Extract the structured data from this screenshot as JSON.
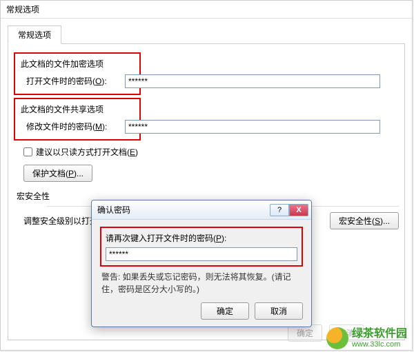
{
  "main": {
    "title": "常规选项",
    "tab_label": "常规选项",
    "section1_title": "此文档的文件加密选项",
    "open_pw_label": "打开文件时的密码(",
    "open_pw_hotkey": "O",
    "open_pw_label_end": "):",
    "open_pw_value": "******",
    "section2_title": "此文档的文件共享选项",
    "modify_pw_label": "修改文件时的密码(",
    "modify_pw_hotkey": "M",
    "modify_pw_label_end": "):",
    "modify_pw_value": "******",
    "readonly_label": "建议以只读方式打开文档(",
    "readonly_hotkey": "E",
    "readonly_label_end": ")",
    "protect_btn": "保护文档(",
    "protect_hotkey": "P",
    "protect_btn_end": ")...",
    "macro_title": "宏安全性",
    "macro_desc": "调整安全级别以打开可能包含宏病毒的文件，并指定可信任的宏创建者姓名。",
    "macro_btn": "宏安全性(",
    "macro_hotkey": "S",
    "macro_btn_end": ")...",
    "footer_ok": "确定",
    "footer_cancel": "取消"
  },
  "confirm": {
    "title": "确认密码",
    "help": "?",
    "close": "X",
    "label": "请再次键入打开文件时的密码(",
    "label_hotkey": "P",
    "label_end": "):",
    "value": "******",
    "warning": "警告: 如果丢失或忘记密码，则无法将其恢复。(请记住，密码是区分大小写的。)",
    "ok": "确定",
    "cancel": "取消"
  },
  "watermark": {
    "name": "绿茶软件园",
    "url": "www.33lc.com"
  }
}
